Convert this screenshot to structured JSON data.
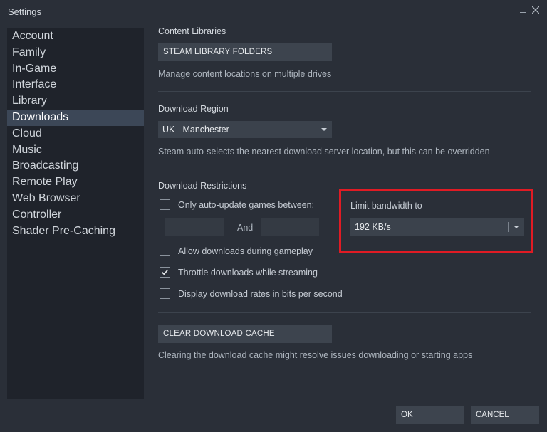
{
  "window": {
    "title": "Settings"
  },
  "sidebar": {
    "items": [
      {
        "label": "Account"
      },
      {
        "label": "Family"
      },
      {
        "label": "In-Game"
      },
      {
        "label": "Interface"
      },
      {
        "label": "Library"
      },
      {
        "label": "Downloads",
        "active": true
      },
      {
        "label": "Cloud"
      },
      {
        "label": "Music"
      },
      {
        "label": "Broadcasting"
      },
      {
        "label": "Remote Play"
      },
      {
        "label": "Web Browser"
      },
      {
        "label": "Controller"
      },
      {
        "label": "Shader Pre-Caching"
      }
    ]
  },
  "content_libraries": {
    "title": "Content Libraries",
    "button": "STEAM LIBRARY FOLDERS",
    "description": "Manage content locations on multiple drives"
  },
  "download_region": {
    "title": "Download Region",
    "selected": "UK - Manchester",
    "description": "Steam auto-selects the nearest download server location, but this can be overridden"
  },
  "download_restrictions": {
    "title": "Download Restrictions",
    "auto_update": {
      "label": "Only auto-update games between:",
      "checked": false
    },
    "and_label": "And",
    "allow_gameplay": {
      "label": "Allow downloads during gameplay",
      "checked": false
    },
    "throttle": {
      "label": "Throttle downloads while streaming",
      "checked": true
    },
    "bits": {
      "label": "Display download rates in bits per second",
      "checked": false
    },
    "bandwidth": {
      "label": "Limit bandwidth to",
      "selected": "192 KB/s"
    }
  },
  "cache": {
    "button": "CLEAR DOWNLOAD CACHE",
    "description": "Clearing the download cache might resolve issues downloading or starting apps"
  },
  "footer": {
    "ok": "OK",
    "cancel": "CANCEL"
  },
  "colors": {
    "background": "#2a2f38",
    "sidebar": "#1f232b",
    "active_item": "#3c4757",
    "highlight_box": "#e01b24"
  }
}
